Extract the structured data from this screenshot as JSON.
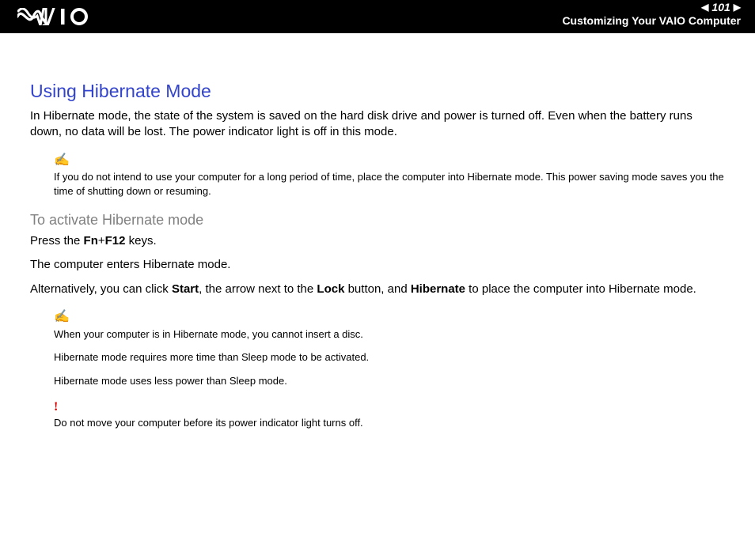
{
  "header": {
    "page_number": "101",
    "section": "Customizing Your VAIO Computer"
  },
  "content": {
    "title": "Using Hibernate Mode",
    "intro": "In Hibernate mode, the state of the system is saved on the hard disk drive and power is turned off. Even when the battery runs down, no data will be lost. The power indicator light is off in this mode.",
    "note1": "If you do not intend to use your computer for a long period of time, place the computer into Hibernate mode. This power saving mode saves you the time of shutting down or resuming.",
    "subheading": "To activate Hibernate mode",
    "step1_pre": "Press the ",
    "step1_keys": "Fn",
    "step1_plus": "+",
    "step1_keys2": "F12",
    "step1_post": " keys.",
    "step2": "The computer enters Hibernate mode.",
    "alt_pre": "Alternatively, you can click ",
    "alt_b1": "Start",
    "alt_mid1": ", the arrow next to the ",
    "alt_b2": "Lock",
    "alt_mid2": " button, and ",
    "alt_b3": "Hibernate",
    "alt_post": " to place the computer into Hibernate mode.",
    "note2a": "When your computer is in Hibernate mode, you cannot insert a disc.",
    "note2b": "Hibernate mode requires more time than Sleep mode to be activated.",
    "note2c": "Hibernate mode uses less power than Sleep mode.",
    "warn": "Do not move your computer before its power indicator light turns off."
  }
}
